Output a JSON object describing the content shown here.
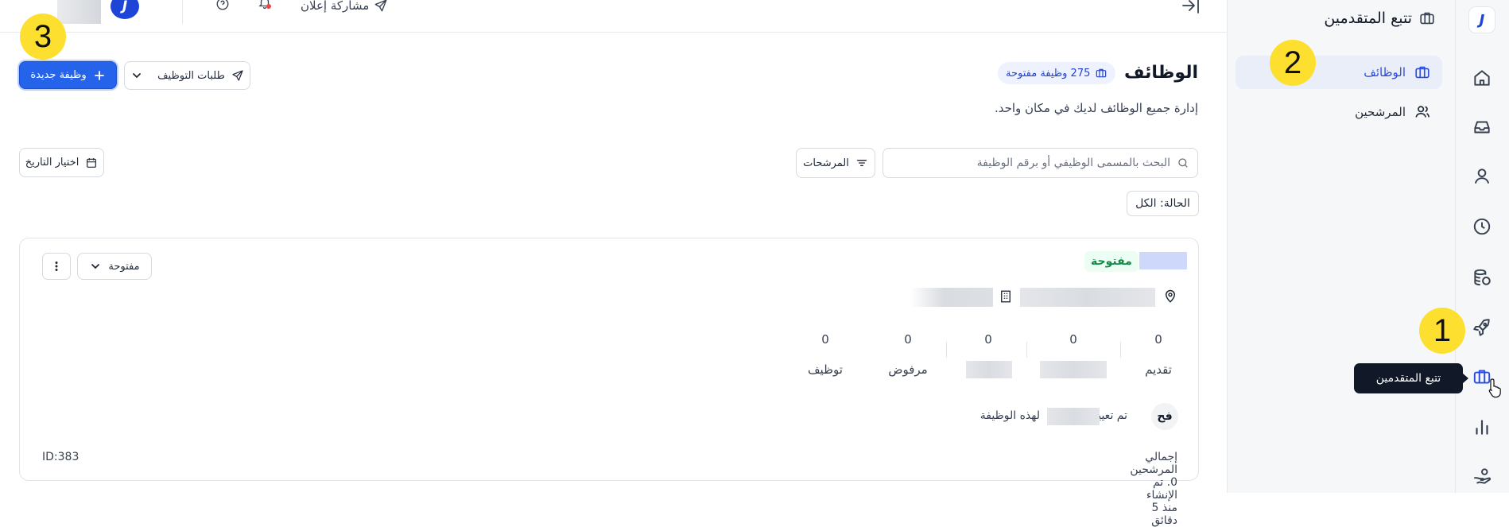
{
  "topbar": {
    "share_label": "مشاركة إعلان",
    "logo_letter": "J"
  },
  "rail": {
    "logo_letter": "J",
    "items": [
      "home-icon",
      "inbox-icon",
      "user-icon",
      "clock-icon",
      "coins-icon",
      "rocket-icon",
      "briefcase-icon",
      "chart-icon",
      "hand-coin-icon"
    ],
    "active": "briefcase-icon",
    "active_color": "#2b4de0"
  },
  "tooltip": {
    "text": "تتبع المتقدمين"
  },
  "sidebar": {
    "title": "تتبع المتقدمين",
    "items": [
      {
        "label": "الوظائف",
        "active": true
      },
      {
        "label": "المرشحين",
        "active": false
      }
    ]
  },
  "callouts": [
    "1",
    "2",
    "3"
  ],
  "header": {
    "title": "الوظائف",
    "count_pill": "275 وظيفة مفتوحة",
    "subtitle": "إدارة جميع الوظائف لديك في مكان واحد.",
    "new_job_label": "وظيفة جديدة",
    "requests_label": "طلبات التوظيف"
  },
  "filters": {
    "search_placeholder": "البحث بالمسمى الوظيفي أو برقم الوظيفة",
    "filters_label": "المرشحات",
    "date_label": "اختيار التاريخ",
    "status_label": "الحالة: الكل"
  },
  "job_card": {
    "status_badge": "مفتوحة",
    "status_select": "مفتوحة",
    "stats": [
      {
        "value": "0",
        "label": "تقديم"
      },
      {
        "value": "0",
        "label": ""
      },
      {
        "value": "0",
        "label": ""
      },
      {
        "value": "0",
        "label": "مرفوض"
      },
      {
        "value": "0",
        "label": "توظيف"
      }
    ],
    "assignee_initials": "فح",
    "assigned_prefix": "تم تعيين",
    "assigned_suffix": "لهذه الوظيفة",
    "summary": "إجمالي المرشحين 0. تم الإنشاء منذ 5 دقائق",
    "id_label": "ID:383"
  },
  "colors": {
    "primary": "#2563eb",
    "accent": "#2b4de0",
    "open_green": "#148a4a",
    "callout": "#fde02f"
  }
}
